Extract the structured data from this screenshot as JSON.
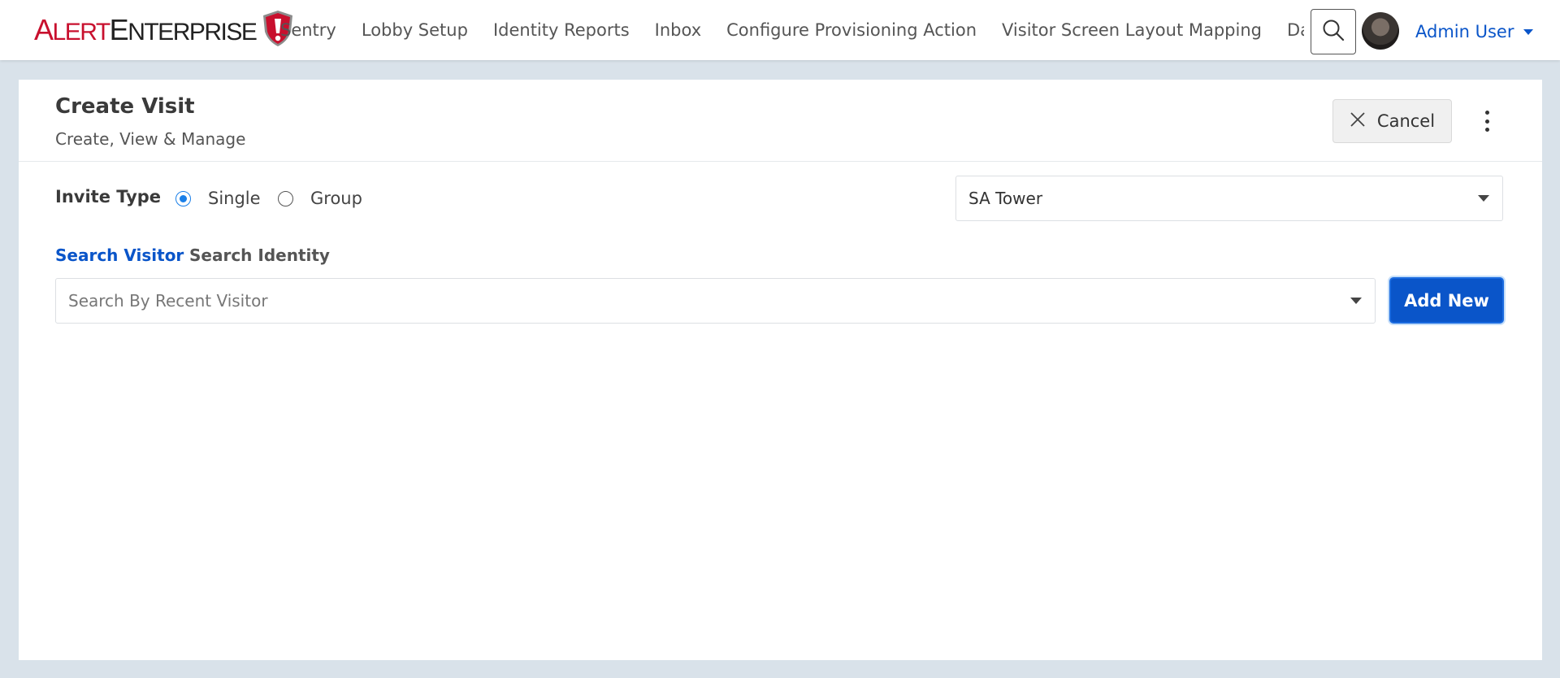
{
  "brand": {
    "logo_text_alert_a": "A",
    "logo_text_alert_rest": "LERT",
    "logo_text_enterprise_e": "E",
    "logo_text_enterprise_rest": "NTERPRISE",
    "logo_accent_color": "#c8102e"
  },
  "nav": {
    "items": [
      {
        "label": "Sentry"
      },
      {
        "label": "Lobby Setup"
      },
      {
        "label": "Identity Reports"
      },
      {
        "label": "Inbox"
      },
      {
        "label": "Configure Provisioning Action"
      },
      {
        "label": "Visitor Screen Layout Mapping"
      },
      {
        "label": "Dasl"
      }
    ],
    "search_icon": "search-icon",
    "user_name": "Admin User",
    "accent_color": "#0a55c9"
  },
  "header": {
    "title": "Create Visit",
    "subtitle": "Create, View & Manage",
    "cancel_label": "Cancel"
  },
  "invite": {
    "label": "Invite Type",
    "options": [
      {
        "label": "Single",
        "checked": true
      },
      {
        "label": "Group",
        "checked": false
      }
    ],
    "location_value": "SA Tower"
  },
  "search": {
    "tabs": [
      {
        "label": "Search Visitor",
        "active": true
      },
      {
        "label": "Search Identity",
        "active": false
      }
    ],
    "placeholder": "Search By Recent Visitor",
    "add_new_label": "Add New"
  }
}
